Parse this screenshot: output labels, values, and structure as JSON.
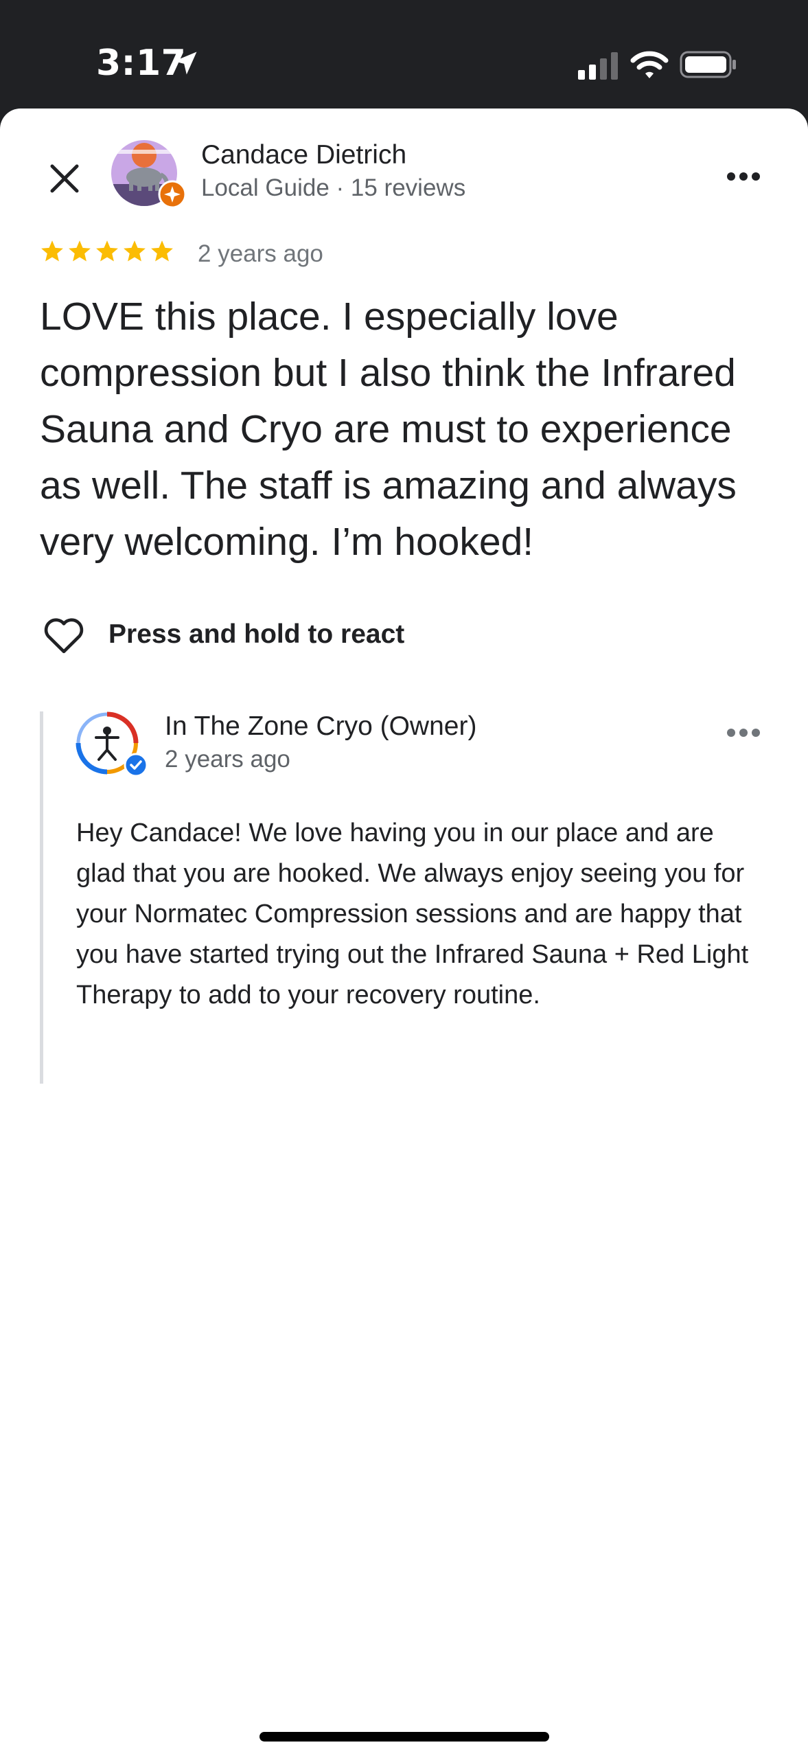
{
  "status_bar": {
    "time": "3:17",
    "icons": [
      "location-arrow-icon",
      "cellular-signal-icon",
      "wifi-icon",
      "battery-icon"
    ]
  },
  "review": {
    "reviewer_name": "Candace Dietrich",
    "reviewer_meta": "Local Guide · 15 reviews",
    "rating": 5,
    "rating_max": 5,
    "date": "2 years ago",
    "text": "LOVE this place. I especially love compression but I also think the Infrared Sauna and Cryo are must to experience as well. The staff is amazing and always very welcoming. I’m hooked!",
    "react_label": "Press and hold to react"
  },
  "owner_reply": {
    "name": "In The Zone Cryo (Owner)",
    "date": "2 years ago",
    "text": "Hey Candace! We love having you in our place and are glad that you are hooked. We always enjoy seeing you for your Normatec Compression sessions and are happy that you have started trying out the Infrared Sauna + Red Light Therapy to add to your recovery routine."
  },
  "colors": {
    "star": "#fbbc04",
    "guide_badge": "#e8710a",
    "verified": "#1a73e8",
    "status_bar_bg": "#202124"
  }
}
